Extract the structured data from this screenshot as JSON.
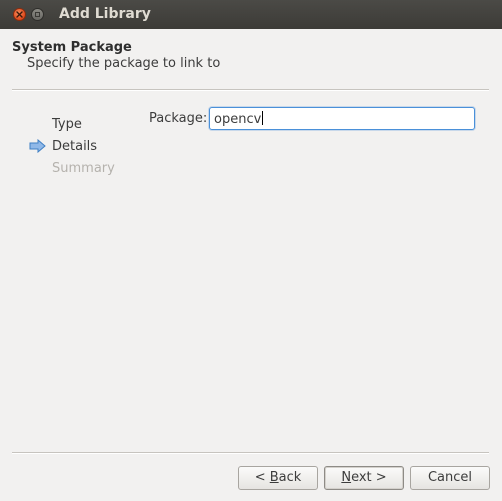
{
  "window": {
    "title": "Add Library"
  },
  "header": {
    "title": "System Package",
    "subtitle": "Specify the package to link to"
  },
  "steps": [
    {
      "label": "Type",
      "state": "done"
    },
    {
      "label": "Details",
      "state": "current"
    },
    {
      "label": "Summary",
      "state": "disabled"
    }
  ],
  "form": {
    "package_label": "Package:",
    "package_value": "opencv"
  },
  "buttons": {
    "back": {
      "prefix": "< ",
      "mnemonic": "B",
      "rest": "ack"
    },
    "next": {
      "mnemonic": "N",
      "rest": "ext >"
    },
    "cancel": "Cancel"
  },
  "icons": {
    "close": "close-icon",
    "maximize": "maximize-icon",
    "current_step": "arrow-right-icon"
  },
  "colors": {
    "titlebar": "#3c3b37",
    "close_button": "#e0491c",
    "focus_border": "#4a90d9",
    "arrow": "#4a90d9"
  }
}
